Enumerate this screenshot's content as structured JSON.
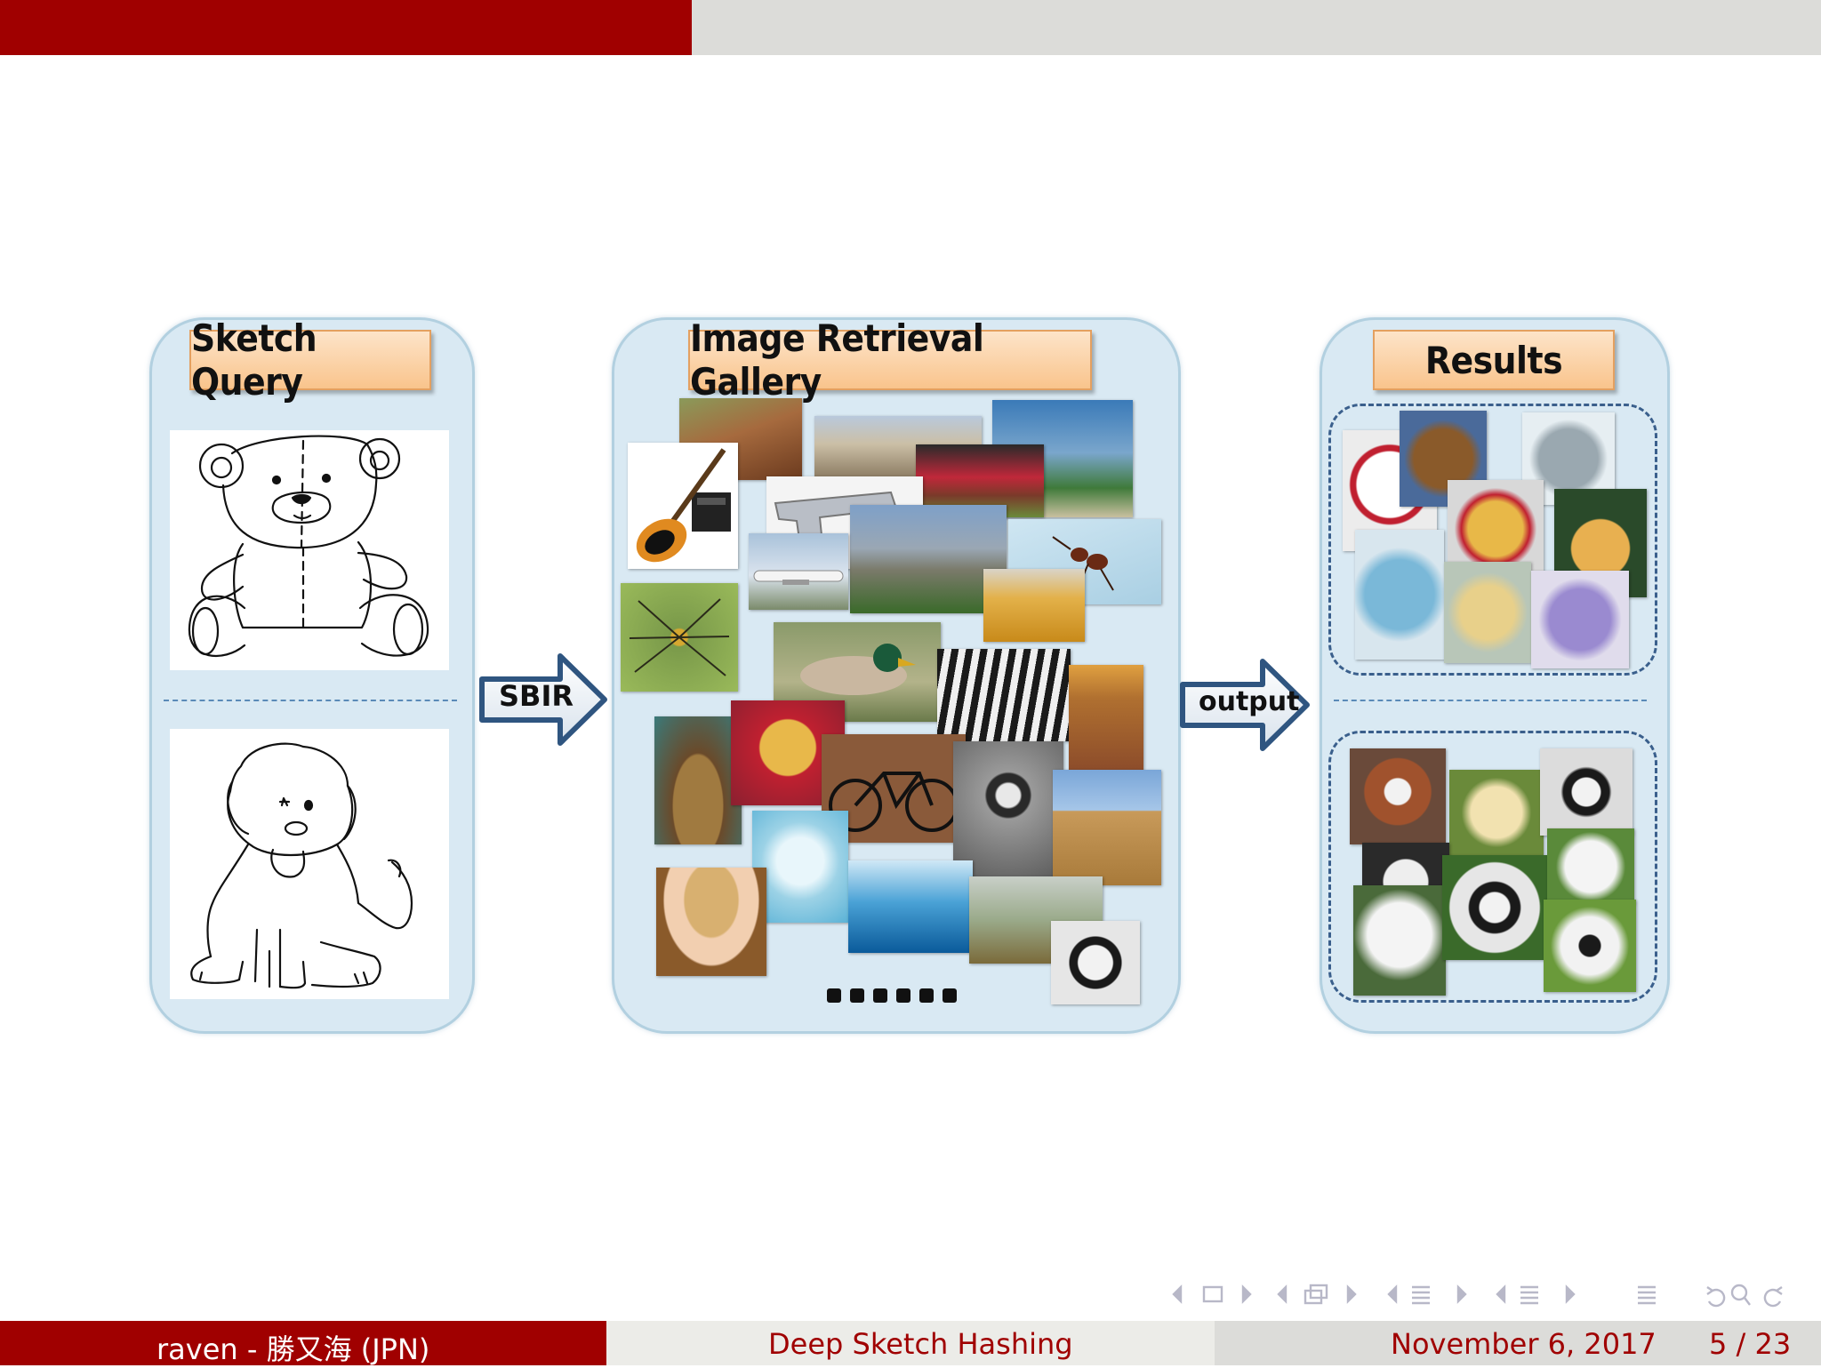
{
  "progress": {
    "fraction": 0.38,
    "fill_color": "#a00000",
    "track_color": "#dcdcd9"
  },
  "panels": {
    "sketch": {
      "title": "Sketch Query"
    },
    "gallery": {
      "title": "Image Retrieval Gallery",
      "ellipsis": "●●●●●●"
    },
    "results": {
      "title": "Results"
    }
  },
  "arrows": {
    "sbir": "SBIR",
    "output": "output"
  },
  "nav_icons": [
    "left-arrow-icon",
    "frame-icon",
    "right-arrow-icon",
    "left-arrow-icon",
    "subsection-icon",
    "right-arrow-icon",
    "left-arrow-icon",
    "section-icon",
    "right-arrow-icon",
    "left-arrow-icon",
    "appendix-icon",
    "right-arrow-icon",
    "toc-icon",
    "undo-icon",
    "search-icon",
    "redo-icon"
  ],
  "footer": {
    "author": "raven - 勝又海 (JPN)",
    "title": "Deep Sketch Hashing",
    "date": "November 6, 2017",
    "page": "5 / 23"
  },
  "colors": {
    "accent": "#a00000",
    "panel_bg": "#d9e9f3",
    "title_bg": "#f9c48c",
    "arrow": "#3a5f8c"
  }
}
